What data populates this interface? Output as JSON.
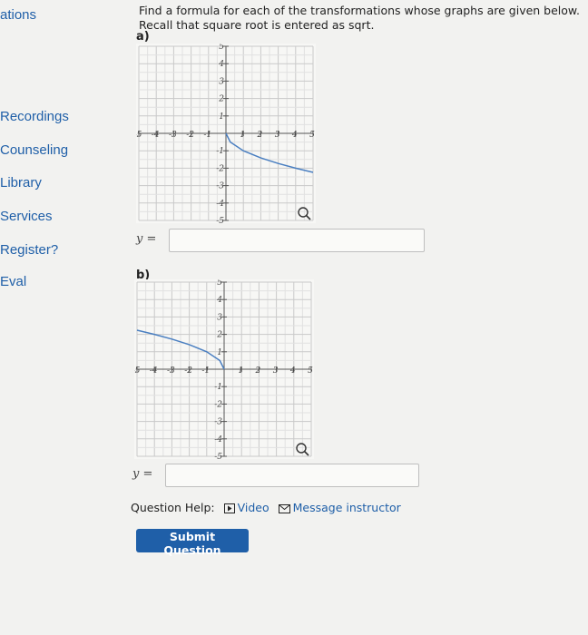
{
  "sidebar": {
    "items": [
      {
        "label": "ations",
        "name": "sidebar-item-ations"
      },
      {
        "label": "Recordings",
        "name": "sidebar-item-recordings"
      },
      {
        "label": "Counseling",
        "name": "sidebar-item-counseling"
      },
      {
        "label": "Library",
        "name": "sidebar-item-library"
      },
      {
        "label": "Services",
        "name": "sidebar-item-services"
      },
      {
        "label": "Register?",
        "name": "sidebar-item-register"
      },
      {
        "label": "Eval",
        "name": "sidebar-item-eval"
      }
    ]
  },
  "question": {
    "instructions": "Find a formula for each of the transformations whose graphs are given below. Recall that square root is entered as sqrt.",
    "parts": [
      {
        "label": "a)",
        "equation_label": "y =",
        "answer": "",
        "zoom_icon": "magnifier-icon"
      },
      {
        "label": "b)",
        "equation_label": "y =",
        "answer": "",
        "zoom_icon": "magnifier-icon"
      }
    ]
  },
  "help": {
    "label": "Question Help:",
    "video_label": "Video",
    "message_label": "Message instructor"
  },
  "submit_label": "Submit Question",
  "colors": {
    "link": "#1f5fa8",
    "curve": "#4a7fc1",
    "button": "#1f5fa8"
  },
  "chart_data": [
    {
      "type": "line",
      "x_ticks": [
        -5,
        -4,
        -3,
        -2,
        -1,
        1,
        2,
        3,
        4,
        5
      ],
      "y_ticks": [
        -5,
        -4,
        -3,
        -2,
        -1,
        1,
        2,
        3,
        4,
        5
      ],
      "xlim": [
        -5,
        5
      ],
      "ylim": [
        -5,
        5
      ],
      "grid": true,
      "series": [
        {
          "x": [
            0,
            0.25,
            1,
            2,
            3,
            4,
            5
          ],
          "y": [
            0,
            -0.5,
            -1,
            -1.41,
            -1.73,
            -2,
            -2.24
          ]
        }
      ]
    },
    {
      "type": "line",
      "x_ticks": [
        -5,
        -4,
        -3,
        -2,
        -1,
        1,
        2,
        3,
        4,
        5
      ],
      "y_ticks": [
        -5,
        -4,
        -3,
        -2,
        -1,
        1,
        2,
        3,
        4,
        5
      ],
      "xlim": [
        -5,
        5
      ],
      "ylim": [
        -5,
        5
      ],
      "grid": true,
      "series": [
        {
          "x": [
            -5,
            -4,
            -3,
            -2,
            -1,
            -0.25,
            0
          ],
          "y": [
            2.24,
            2,
            1.73,
            1.41,
            1,
            0.5,
            0
          ]
        }
      ]
    }
  ]
}
